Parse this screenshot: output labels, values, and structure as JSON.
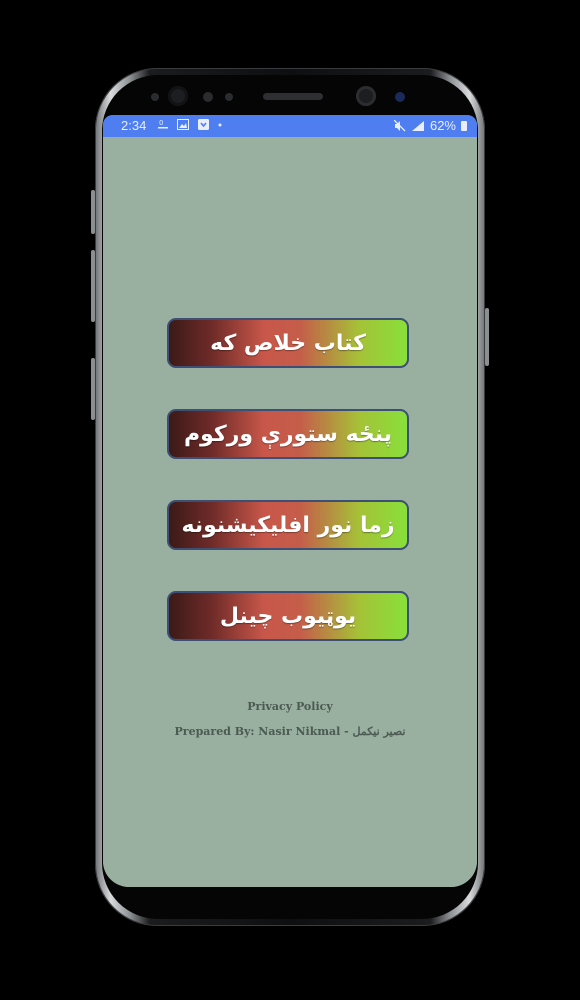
{
  "status_bar": {
    "time": "2:34",
    "battery_percent": "62%",
    "icons_left": [
      "data-speed-icon",
      "image-icon",
      "download-icon",
      "dot-icon"
    ],
    "icons_right": [
      "mute-icon",
      "lte-signal-icon",
      "battery-icon"
    ]
  },
  "menu": {
    "buttons": [
      {
        "label": "کتاب خلاص که"
      },
      {
        "label": "پنځه ستورې ورکوم"
      },
      {
        "label": "زما نور افلیکیشنونه"
      },
      {
        "label": "یوټیوب چینل"
      }
    ]
  },
  "footer": {
    "privacy_label": "Privacy Policy",
    "prepared_by": "Prepared By: Nasir Nikmal - نصیر نیکمل"
  },
  "colors": {
    "status_bar": "#4f7ef0",
    "screen_background": "#99af9f",
    "button_border": "#3d4f75",
    "button_gradient_start": "#3b1a18",
    "button_gradient_mid": "#c8574a",
    "button_gradient_end": "#88e03a",
    "footer_text": "#4b5a52"
  }
}
